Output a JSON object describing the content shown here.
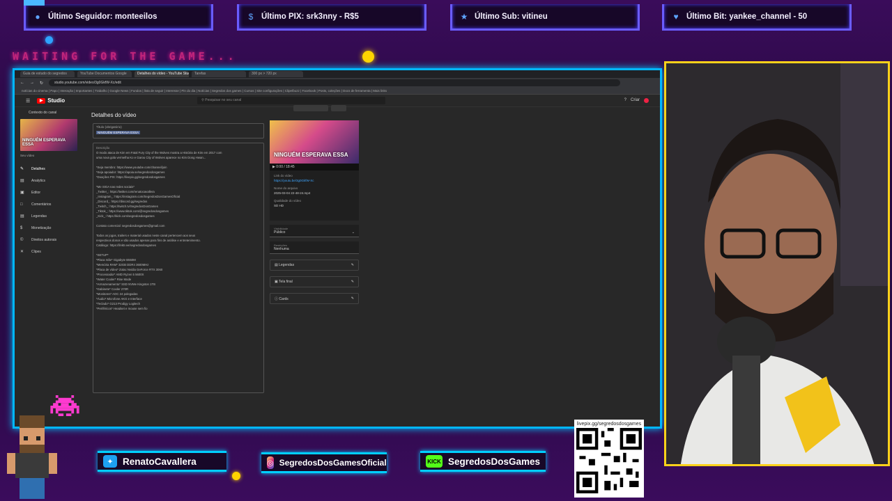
{
  "alerts": [
    {
      "icon": "person-icon",
      "text": "Último Seguidor: monteeilos"
    },
    {
      "icon": "dollar-icon",
      "text": "Último PIX: srk3nny - R$5"
    },
    {
      "icon": "star-icon",
      "text": "Último Sub: vitineu"
    },
    {
      "icon": "heart-icon",
      "text": "Último Bit: yankee_channel - 50"
    }
  ],
  "waiting_text": "WAITING FOR THE GAME...",
  "browser": {
    "tabs": [
      "Guia de estudo do segredos",
      "YouTube Documentos Google",
      "Detalhes do vídeo - YouTube Studio",
      "Tarefas",
      "300 px > 720 px"
    ],
    "url": "studio.youtube.com/video/3g0GkfW-Xc/edit",
    "bookmarks": "notícias do cinema | Papo | Interação | Importantes | Trabalho | Google News | Fundos | lista de seguir | Interesse | Pin do dia | Notícias | Segredos dos games | Cursos | Site configurações | Clipe/buzz | Facebook | Posts, coleções | Docs de ferramenta | Mais links"
  },
  "studio": {
    "logo": "Studio",
    "search_placeholder": "Pesquisar no seu canal",
    "create_label": "Criar",
    "back_label": "Contexto do canal",
    "page_title": "Detalhes do vídeo",
    "sidebar_thumb_text": "NINGUÉM ESPERAVA ESSA",
    "sidebar_sub": "Seu vídeo",
    "sidebar_items": [
      {
        "icon": "pencil-icon",
        "label": "Detalhes"
      },
      {
        "icon": "analytics-icon",
        "label": "Analytics"
      },
      {
        "icon": "editor-icon",
        "label": "Editor"
      },
      {
        "icon": "comments-icon",
        "label": "Comentários"
      },
      {
        "icon": "subtitles-icon",
        "label": "Legendas"
      },
      {
        "icon": "money-icon",
        "label": "Monetização"
      },
      {
        "icon": "copyright-icon",
        "label": "Direitos autorais"
      },
      {
        "icon": "clips-icon",
        "label": "Clipes"
      }
    ],
    "title_field_label": "Título (obrigatório)",
    "title_field_value": "NINGUÉM ESPERAVA ESSA",
    "description_label": "Descrição",
    "description_lines": [
      "O modo ataca de Kim em Fatal Fury City of the Wolves mostra a História de Kim em 2017 com",
      "uma nova gola vermelha Ko e Garou City of Wolves aparece no Kim Dong Hwan...",
      "",
      "*Seja membro: https://www.youtube.com/channel/join",
      "*Seja apoiador: https://apoia.se/segredosdosgames",
      "*Doações PIX: https://livepix.gg/segredosdosgames",
      "",
      "*Me SIGA nas redes sociais*",
      "_Twitter_: https://twitter.com/renatocavallera",
      "_Instagram_: https://instagram.com/SegredosDosGamesOficial",
      "_Discord_: https://discord.gg/segredos",
      "_Twitch_: https://twitch.tv/SegredosDosGames",
      "_Tiktok_: https://www.tiktok.com/@segredosdosgames",
      "_Kick_: https://kick.com/segredosdosgames",
      "",
      "Contato comercial: segredosdosgames@gmail.com",
      "",
      "Todos os jogos, trailers e material usados neste canal pertencem aos seus",
      "respectivos donos e são usados apenas para fins de análise e entretenimento.",
      "Catálogo: https://linktr.ee/segredosdosgames",
      "",
      "*SETUP*",
      "*Placa mãe* Gigabyte B550M",
      "*Memória RAM* 32GB DDR4 3600MHz",
      "*Placa de vídeo* Zotac Nvidia GeForce RTX 3060",
      "*Processador* AMD Ryzen 5 5600X",
      "*Water Cooler* Rise Mode",
      "*Armazenamento* SSD NVMe Kingston 1TB",
      "*Gabinete* Cooler 270R",
      "*Monitores* AOC 24 polegadas",
      "*Áudio* Microfone AKG e Interface",
      "*Teclado* G213 Prodigy Logitech",
      "*Periféricos* Headset e mouse sem fio"
    ],
    "video_thumb_text": "NINGUÉM ESPERAVA ESSA",
    "video_time": "0:00 / 18:45",
    "video_link_label": "Link do vídeo",
    "video_link": "https://youtu.be/3g0GkfW-Xc",
    "filename_label": "Nome do arquivo",
    "filename": "2025-03-04 22-48-24.mp4",
    "quality_label": "Qualidade do vídeo",
    "quality": "SD HD",
    "visibility_label": "Visibilidade",
    "visibility": "Público",
    "restrictions_label": "Restrições",
    "restrictions": "Nenhuma",
    "rows": [
      {
        "icon": "subtitles-icon",
        "label": "Legendas"
      },
      {
        "icon": "endscreen-icon",
        "label": "Tela final"
      },
      {
        "icon": "cards-icon",
        "label": "Cards"
      }
    ]
  },
  "socials": [
    {
      "icon": "twitter-icon",
      "color": "#1da1f2",
      "name": "RenatoCavallera"
    },
    {
      "icon": "instagram-icon",
      "color": "#c13584",
      "name": "SegredosDosGamesOficial"
    },
    {
      "icon": "kick-icon",
      "color": "#53fc18",
      "name": "SegredosDosGames",
      "prefix": "KICK"
    }
  ],
  "qr": {
    "caption": "livepix.gg/segredosdosgames"
  },
  "colors": {
    "accent_cyan": "#00cfff",
    "accent_purple": "#6a5cff",
    "cam_border": "#ffd21a",
    "magenta": "#ff1a9a"
  }
}
